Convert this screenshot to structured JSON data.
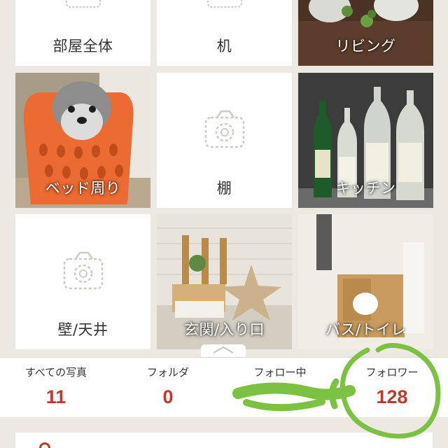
{
  "tiles": [
    {
      "label": "部屋全体"
    },
    {
      "label": "机"
    },
    {
      "label": "リビング"
    },
    {
      "label": "ベッド周り"
    },
    {
      "label": "棚"
    },
    {
      "label": "キッチン"
    },
    {
      "label": "壁/天井"
    },
    {
      "label": "玄関/入り口"
    },
    {
      "label": "バス/トイレ"
    }
  ],
  "stats": [
    {
      "label": "すべての写真",
      "value": "11"
    },
    {
      "label": "フォルダ",
      "value": "0"
    },
    {
      "label": "フォロー中",
      "value": ""
    },
    {
      "label": "フォロワー",
      "value": "128"
    }
  ],
  "colors": {
    "accent": "#c0392b",
    "background": "#ece9e3",
    "annotation": "#7cc242"
  },
  "icons": [
    "camera-icon",
    "chevron-up-icon",
    "location-pin-icon"
  ]
}
